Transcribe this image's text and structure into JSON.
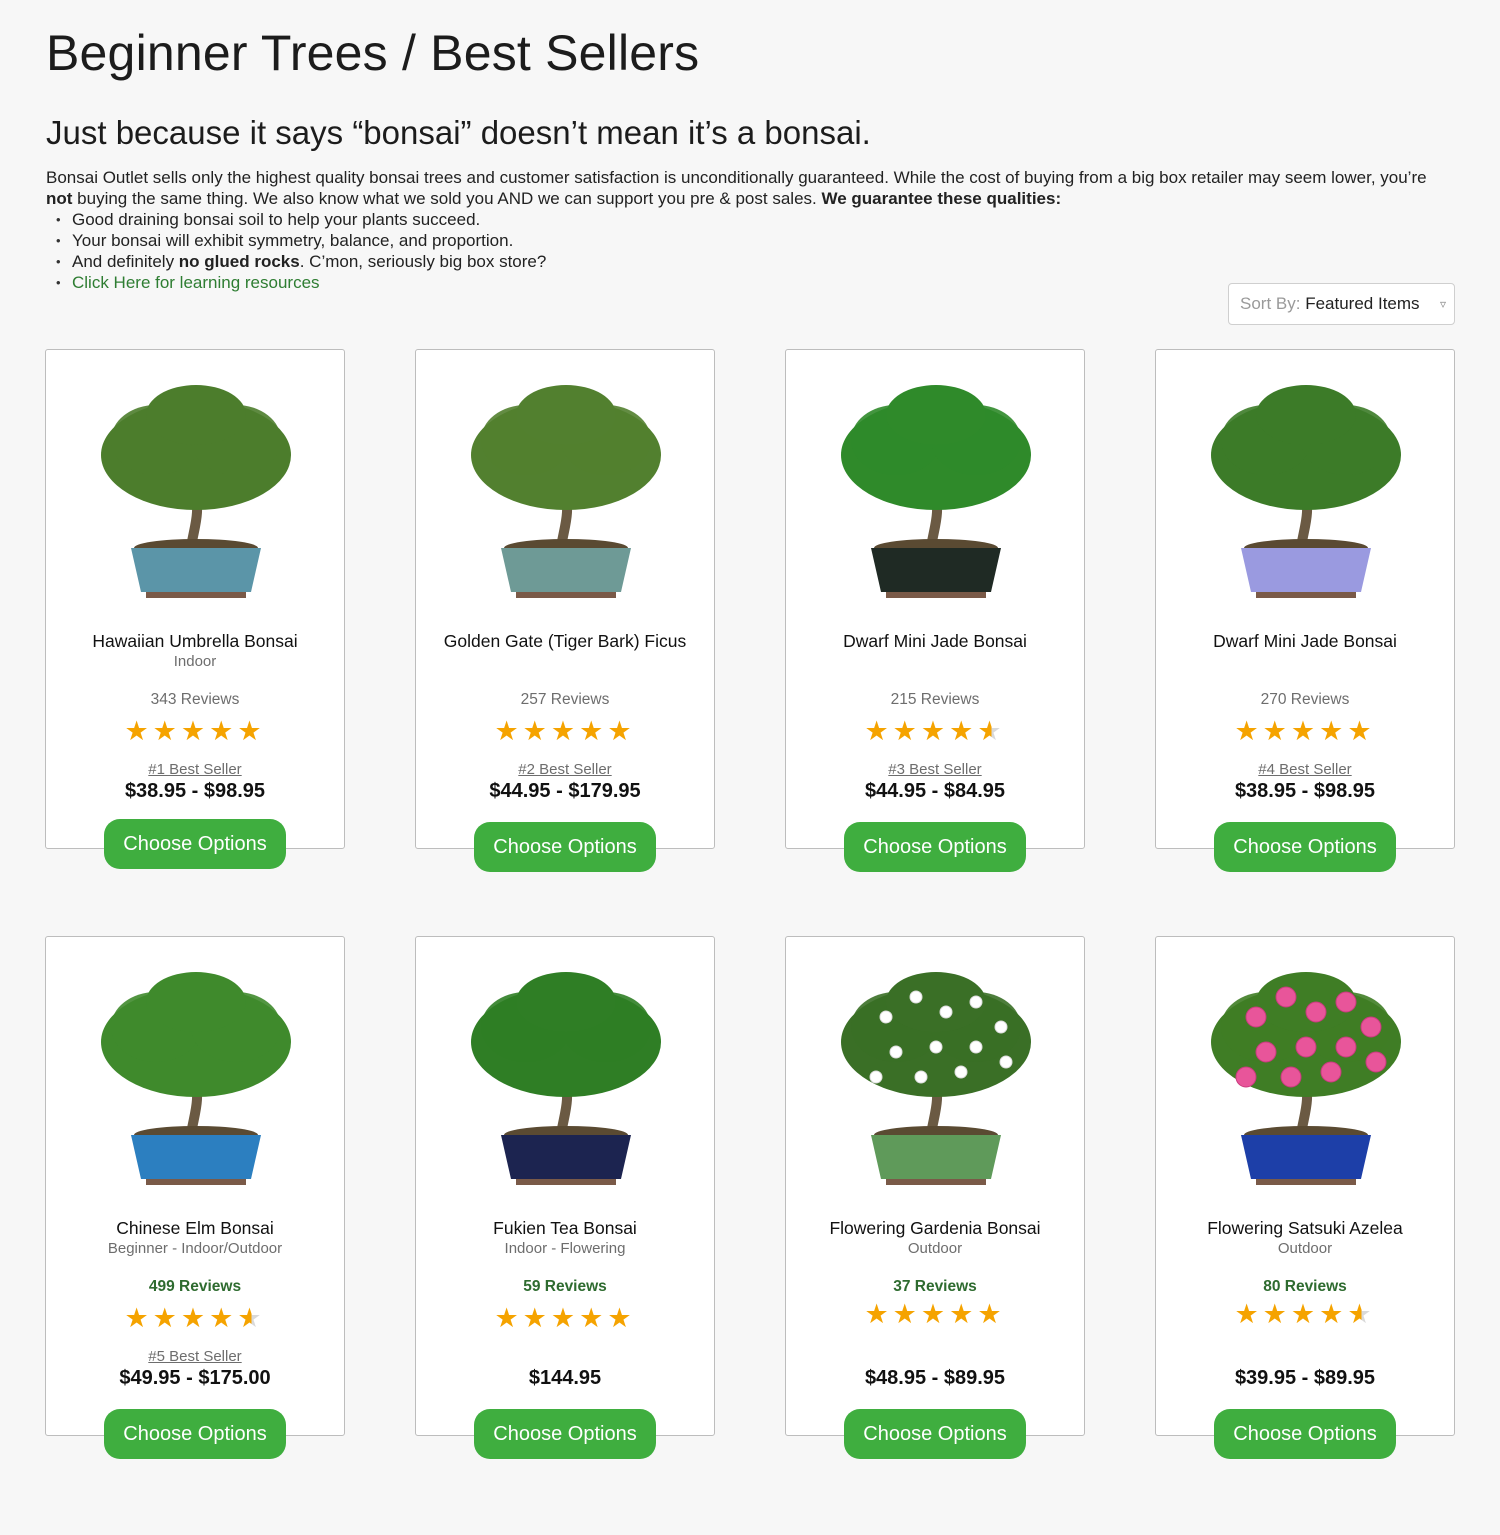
{
  "page": {
    "title": "Beginner Trees / Best Sellers",
    "subtitle": "Just because it says “bonsai” doesn’t mean it’s a bonsai.",
    "intro": {
      "p1": "Bonsai Outlet sells only the highest quality bonsai trees and customer satisfaction is unconditionally guaranteed. While the cost of buying from a big box retailer may seem lower, you’re ",
      "p1_bold": "not",
      "p2": " buying the same thing. We also know what we sold you AND we can support you pre & post sales. ",
      "p2_bold": "We guarantee these qualities:",
      "bullet1": "Good draining bonsai soil to help your plants succeed.",
      "bullet2": "Your bonsai will exhibit symmetry, balance, and proportion.",
      "bullet3_pre": "And definitely ",
      "bullet3_bold": "no glued rocks",
      "bullet3_post": ". C’mon, seriously big box store?",
      "bullet4_link": "Click Here for learning resources"
    },
    "sort": {
      "label": "Sort By:",
      "value": "Featured Items",
      "caret": "▿"
    },
    "button_label": "Choose Options"
  },
  "products": [
    {
      "name": "Hawaiian Umbrella Bonsai",
      "meta": "Indoor",
      "reviews": "343 Reviews",
      "rating": 5,
      "seller": "#1 Best Seller",
      "price": "$38.95 - $98.95",
      "pot": "#5b95a8",
      "foliage": "#4c7d2c"
    },
    {
      "name": "Golden Gate (Tiger Bark) Ficus",
      "meta": "",
      "reviews": "257 Reviews",
      "rating": 5,
      "seller": "#2 Best Seller",
      "price": "$44.95 - $179.95",
      "pot": "#6e9a96",
      "foliage": "#52802f"
    },
    {
      "name": "Dwarf Mini Jade Bonsai",
      "meta": "",
      "reviews": "215 Reviews",
      "rating": 4.5,
      "seller": "#3 Best Seller",
      "price": "$44.95 - $84.95",
      "pot": "#1f2a24",
      "foliage": "#2f8a2a"
    },
    {
      "name": "Dwarf Mini Jade Bonsai",
      "meta": "",
      "reviews": "270 Reviews",
      "rating": 5,
      "seller": "#4 Best Seller",
      "price": "$38.95 - $98.95",
      "pot": "#9a9ae0",
      "foliage": "#3c7b28"
    },
    {
      "name": "Chinese Elm Bonsai",
      "meta": "Beginner - Indoor/Outdoor",
      "reviews": "499 Reviews",
      "rating": 4.5,
      "seller": "#5 Best Seller",
      "price": "$49.95 - $175.00",
      "pot": "#2c7fc0",
      "foliage": "#3f8a2c"
    },
    {
      "name": "Fukien Tea Bonsai",
      "meta": "Indoor - Flowering",
      "reviews": "59 Reviews",
      "rating": 5,
      "seller": "",
      "price": "$144.95",
      "pot": "#1c2450",
      "foliage": "#2f7e25"
    },
    {
      "name": "Flowering Gardenia Bonsai",
      "meta": "Outdoor",
      "reviews": "37 Reviews",
      "rating": 5,
      "seller": "",
      "price": "$48.95 - $89.95",
      "pot": "#5f9a5a",
      "foliage": "#3a6f26"
    },
    {
      "name": "Flowering Satsuki Azelea",
      "meta": "Outdoor",
      "reviews": "80 Reviews",
      "rating": 4.5,
      "seller": "",
      "price": "$39.95 - $89.95",
      "pot": "#1d3fa8",
      "foliage": "#e8559a"
    }
  ]
}
